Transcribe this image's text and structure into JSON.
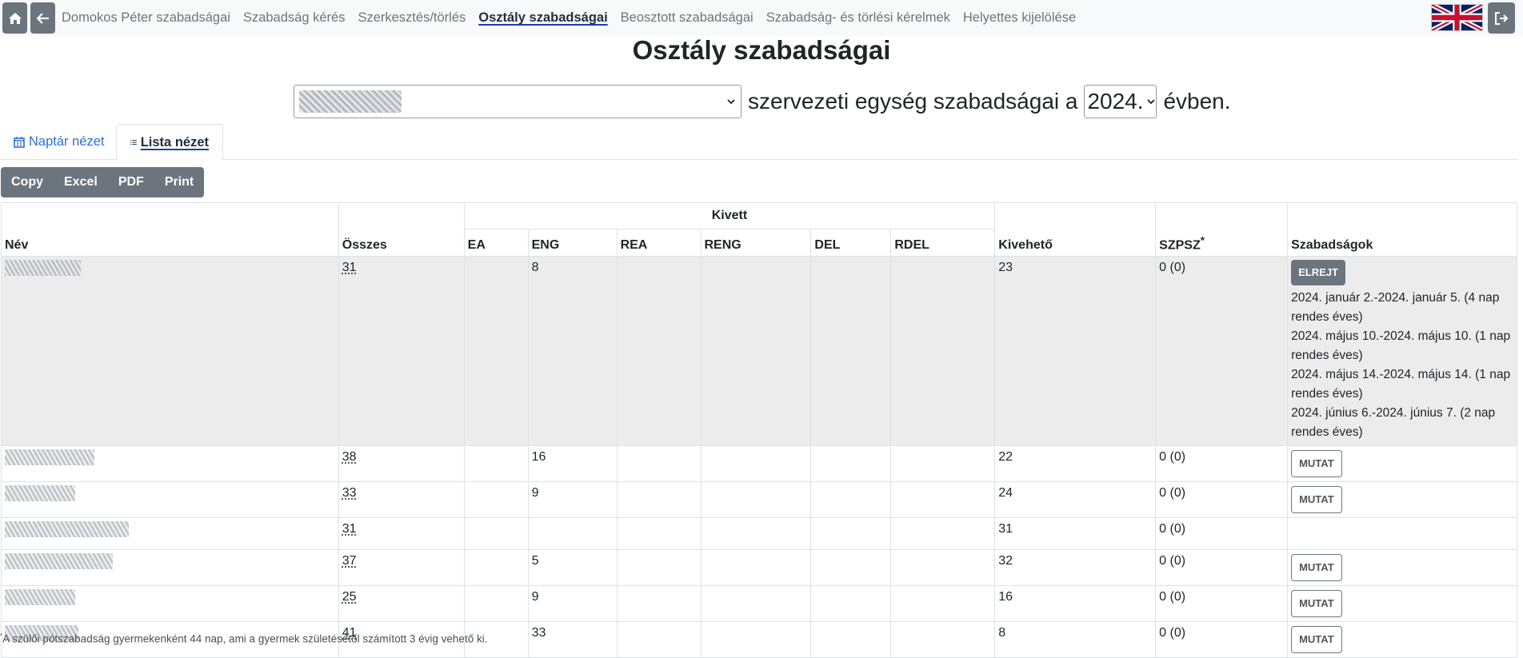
{
  "nav": {
    "links": [
      {
        "label": "Domokos Péter szabadságai",
        "active": false
      },
      {
        "label": "Szabadság kérés",
        "active": false
      },
      {
        "label": "Szerkesztés/törlés",
        "active": false
      },
      {
        "label": "Osztály szabadságai",
        "active": true
      },
      {
        "label": "Beosztott szabadságai",
        "active": false
      },
      {
        "label": "Szabadság- és törlési kérelmek",
        "active": false
      },
      {
        "label": "Helyettes kijelölése",
        "active": false
      }
    ],
    "icons": {
      "home": "home-icon",
      "back": "arrow-left-icon",
      "language": "uk-flag-icon",
      "logout": "logout-icon"
    }
  },
  "page": {
    "title": "Osztály szabadságai",
    "selector": {
      "text_after_unit": "szervezeti egység szabadságai a",
      "year": "2024.",
      "text_after_year": "évben."
    }
  },
  "tabs": [
    {
      "label": "Naptár nézet",
      "icon": "calendar-icon",
      "active": false
    },
    {
      "label": "Lista nézet",
      "icon": "list-icon",
      "active": true
    }
  ],
  "export_buttons": [
    "Copy",
    "Excel",
    "PDF",
    "Print"
  ],
  "table": {
    "headers": {
      "name": "Név",
      "total": "Összes",
      "taken_group": "Kivett",
      "taken": [
        "EA",
        "ENG",
        "REA",
        "RENG",
        "DEL",
        "RDEL"
      ],
      "available": "Kivehető",
      "szpsz": "SZPSZ",
      "szpsz_mark": "*",
      "leaves": "Szabadságok"
    },
    "rows": [
      {
        "total": "31",
        "ea": "",
        "eng": "8",
        "rea": "",
        "reng": "",
        "del": "",
        "rdel": "",
        "available": "23",
        "szpsz": "0 (0)",
        "button": "ELREJT",
        "leaves": [
          "2024. január 2.-2024. január 5. (4 nap rendes éves)",
          "2024. május 10.-2024. május 10. (1 nap rendes éves)",
          "2024. május 14.-2024. május 14. (1 nap rendes éves)",
          "2024. június 6.-2024. június 7. (2 nap rendes éves)"
        ]
      },
      {
        "total": "38",
        "ea": "",
        "eng": "16",
        "rea": "",
        "reng": "",
        "del": "",
        "rdel": "",
        "available": "22",
        "szpsz": "0 (0)",
        "button": "MUTAT",
        "leaves": []
      },
      {
        "total": "33",
        "ea": "",
        "eng": "9",
        "rea": "",
        "reng": "",
        "del": "",
        "rdel": "",
        "available": "24",
        "szpsz": "0 (0)",
        "button": "MUTAT",
        "leaves": []
      },
      {
        "total": "31",
        "ea": "",
        "eng": "",
        "rea": "",
        "reng": "",
        "del": "",
        "rdel": "",
        "available": "31",
        "szpsz": "0 (0)",
        "button": "",
        "leaves": []
      },
      {
        "total": "37",
        "ea": "",
        "eng": "5",
        "rea": "",
        "reng": "",
        "del": "",
        "rdel": "",
        "available": "32",
        "szpsz": "0 (0)",
        "button": "MUTAT",
        "leaves": []
      },
      {
        "total": "25",
        "ea": "",
        "eng": "9",
        "rea": "",
        "reng": "",
        "del": "",
        "rdel": "",
        "available": "16",
        "szpsz": "0 (0)",
        "button": "MUTAT",
        "leaves": []
      },
      {
        "total": "41",
        "ea": "",
        "eng": "33",
        "rea": "",
        "reng": "",
        "del": "",
        "rdel": "",
        "available": "8",
        "szpsz": "0 (0)",
        "button": "MUTAT",
        "leaves": []
      }
    ]
  },
  "footnote": {
    "mark": "*",
    "text": "A szülői pótszabadság gyermekenként 44 nap, ami a gyermek születésétől számított 3 évig vehető ki."
  }
}
